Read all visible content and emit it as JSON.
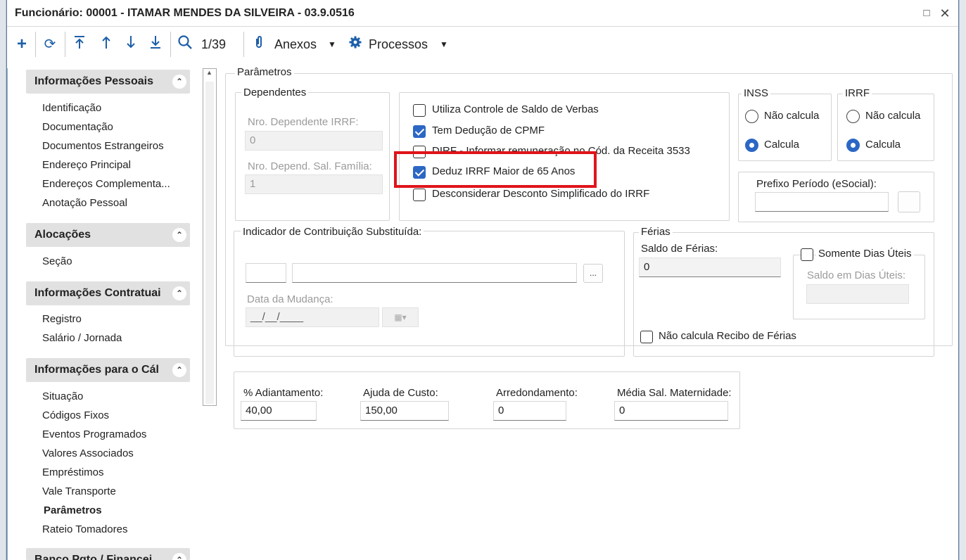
{
  "window": {
    "title": "Funcionário: 00001 - ITAMAR MENDES DA SILVEIRA - 03.9.0516",
    "maximize_glyph": "□",
    "close_glyph": "✕"
  },
  "toolbar": {
    "record_counter": "1/39",
    "attachments_label": "Anexos",
    "processes_label": "Processos",
    "icons": [
      "add-icon",
      "refresh-icon",
      "first-record-icon",
      "previous-record-icon",
      "next-record-icon",
      "last-record-icon",
      "search-icon",
      "paperclip-icon",
      "gear-icon"
    ]
  },
  "sidebar": {
    "sections": [
      {
        "title": "Informações Pessoais",
        "items": [
          "Identificação",
          "Documentação",
          "Documentos Estrangeiros",
          "Endereço Principal",
          "Endereços Complementa...",
          "Anotação Pessoal"
        ]
      },
      {
        "title": "Alocações",
        "items": [
          "Seção"
        ]
      },
      {
        "title": "Informações Contratuai",
        "items": [
          "Registro",
          "Salário / Jornada"
        ]
      },
      {
        "title": "Informações para o Cál",
        "items": [
          "Situação",
          "Códigos Fixos",
          "Eventos Programados",
          "Valores Associados",
          "Empréstimos",
          "Vale Transporte",
          "Parâmetros",
          "Rateio Tomadores"
        ]
      },
      {
        "title": "Banco Pgto / Financei"
      }
    ],
    "active_item": "Parâmetros",
    "collapse_glyph": "⌃"
  },
  "parametros": {
    "title": "Parâmetros",
    "dependentes": {
      "title": "Dependentes",
      "irrf_label": "Nro. Dependente IRRF:",
      "irrf_value": "0",
      "salfam_label": "Nro. Depend. Sal. Família:",
      "salfam_value": "1"
    },
    "options": [
      {
        "label": "Utiliza Controle de Saldo de Verbas",
        "checked": false
      },
      {
        "label": "Tem Dedução de CPMF",
        "checked": true
      },
      {
        "label": "DIRF - Informar remuneração no Cód. da Receita 3533",
        "checked": false
      },
      {
        "label": "Deduz IRRF Maior de 65 Anos",
        "checked": true
      },
      {
        "label": "Desconsiderar Desconto Simplificado do IRRF",
        "checked": false
      }
    ],
    "inss": {
      "title": "INSS",
      "opt1": "Não calcula",
      "opt2": "Calcula",
      "selected": "Calcula"
    },
    "irrf": {
      "title": "IRRF",
      "opt1": "Não calcula",
      "opt2": "Calcula",
      "selected": "Calcula"
    },
    "prefixo": {
      "label": "Prefixo Período (eSocial):",
      "value": ""
    },
    "contrib": {
      "title": "Indicador de Contribuição Substituída:",
      "code": "",
      "desc": "",
      "lookup_label": "...",
      "date_label": "Data da Mudança:",
      "date_value": "__/__/____"
    },
    "ferias": {
      "title": "Férias",
      "saldo_label": "Saldo de Férias:",
      "saldo_value": "0",
      "somente_label": "Somente Dias Úteis",
      "somente_checked": false,
      "saldo_uteis_label": "Saldo em Dias Úteis:",
      "saldo_uteis_value": "",
      "nao_calcula_label": "Não calcula Recibo de Férias",
      "nao_calcula_checked": false
    },
    "bottom": {
      "adiant_label": "% Adiantamento:",
      "adiant_value": "40,00",
      "ajuda_label": "Ajuda de Custo:",
      "ajuda_value": "150,00",
      "arred_label": "Arredondamento:",
      "arred_value": "0",
      "media_label": "Média Sal. Maternidade:",
      "media_value": "0"
    }
  },
  "highlight_color": "#e0141b",
  "accent_color": "#2c67c4"
}
